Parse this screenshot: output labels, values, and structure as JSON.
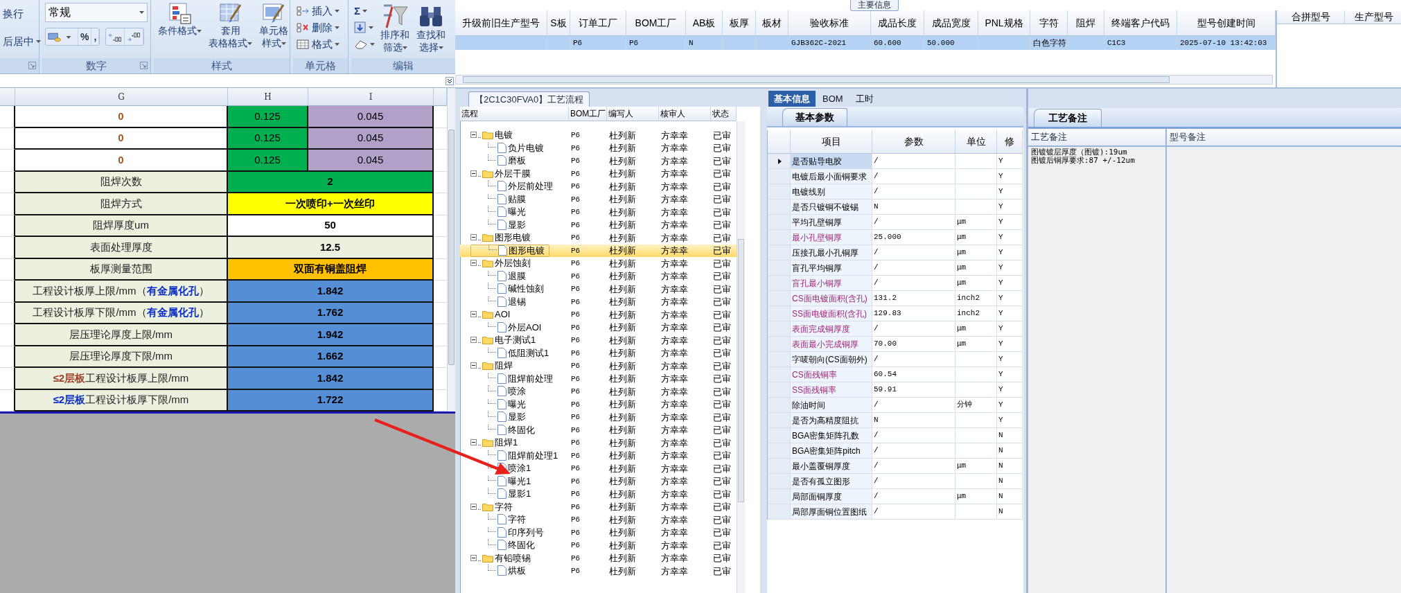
{
  "ribbon": {
    "groups": [
      {
        "kind": "alignment",
        "items": [
          "换行",
          "后居中"
        ]
      },
      {
        "kind": "number",
        "label": "数字",
        "format": "常规",
        "buttons": [
          "%",
          ","
        ]
      },
      {
        "kind": "styles",
        "label": "样式",
        "buttons": [
          {
            "lines": [
              "条件格式"
            ]
          },
          {
            "lines": [
              "套用",
              "表格格式"
            ]
          },
          {
            "lines": [
              "单元格",
              "样式"
            ]
          }
        ]
      },
      {
        "kind": "cells",
        "label": "单元格",
        "buttons": [
          "插入",
          "删除",
          "格式"
        ]
      },
      {
        "kind": "editing",
        "label": "编辑",
        "small": [
          "Σ"
        ],
        "buttons": [
          {
            "lines": [
              "排序和",
              "筛选"
            ]
          },
          {
            "lines": [
              "查找和",
              "选择"
            ]
          }
        ]
      }
    ]
  },
  "sheet": {
    "columns": [
      "G",
      "H",
      "I"
    ],
    "rows": [
      {
        "kind": "values",
        "cells": [
          {
            "text": "0",
            "color": "#ffffff"
          },
          {
            "text": "0.125",
            "color": "#00b050"
          },
          {
            "text": "0.045",
            "color": "#b1a0c7"
          }
        ]
      },
      {
        "kind": "values",
        "cells": [
          {
            "text": "0",
            "color": "#ffffff"
          },
          {
            "text": "0.125",
            "color": "#00b050"
          },
          {
            "text": "0.045",
            "color": "#b1a0c7"
          }
        ]
      },
      {
        "kind": "values",
        "cells": [
          {
            "text": "0",
            "color": "#ffffff"
          },
          {
            "text": "0.125",
            "color": "#00b050"
          },
          {
            "text": "0.045",
            "color": "#b1a0c7"
          }
        ]
      },
      {
        "kind": "merged",
        "label": "阻焊次数",
        "value": "2",
        "color": "#00b050"
      },
      {
        "kind": "merged",
        "label": "阻焊方式",
        "value": "一次喷印+一次丝印",
        "color": "#ffff00"
      },
      {
        "kind": "merged",
        "label": "阻焊厚度um",
        "value": "50",
        "color": "#ffffff"
      },
      {
        "kind": "merged",
        "label": "表面处理厚度",
        "value": "12.5",
        "color": "#ebf1de"
      },
      {
        "kind": "merged",
        "label": "板厚测量范围",
        "value": "双面有铜盖阻焊",
        "color": "#ffc000"
      },
      {
        "kind": "merged",
        "label": "工程设计板厚上限/mm（**有金属化孔**）",
        "accent": {
          "color": "#0b2fc8"
        },
        "value": "1.842",
        "color": "#558ed5"
      },
      {
        "kind": "merged",
        "label": "工程设计板厚下限/mm（**有金属化孔**）",
        "accent": {
          "color": "#0b2fc8"
        },
        "value": "1.762",
        "color": "#558ed5"
      },
      {
        "kind": "merged",
        "label": "层压理论厚度上限/mm",
        "value": "1.942",
        "color": "#558ed5"
      },
      {
        "kind": "merged",
        "label": "层压理论厚度下限/mm",
        "value": "1.662",
        "color": "#558ed5"
      },
      {
        "kind": "merged",
        "label": "**≤2层板**工程设计板厚上限/mm",
        "accent": {
          "color": "#a0402a"
        },
        "value": "1.842",
        "color": "#558ed5"
      },
      {
        "kind": "merged",
        "label": "**≤2层板**工程设计板厚下限/mm",
        "accent": {
          "color": "#0b2fc8"
        },
        "value": "1.722",
        "color": "#558ed5"
      }
    ]
  },
  "main_info": {
    "title": "主要信息",
    "columns": [
      {
        "label": "升级前旧生产型号"
      },
      {
        "label": "S板"
      },
      {
        "label": "订单工厂",
        "value": "P6"
      },
      {
        "label": "BOM工厂",
        "value": "P6"
      },
      {
        "label": "AB板",
        "value": "N"
      },
      {
        "label": "板厚"
      },
      {
        "label": "板材"
      },
      {
        "label": "验收标准",
        "value": "GJB362C-2021"
      },
      {
        "label": "成品长度",
        "value": "60.600"
      },
      {
        "label": "成品宽度",
        "value": "50.000"
      },
      {
        "label": "PNL规格"
      },
      {
        "label": "字符",
        "value": "白色字符"
      },
      {
        "label": "阻焊"
      },
      {
        "label": "终端客户代码",
        "value": "C1C3"
      },
      {
        "label": "型号创建时间",
        "value": "2025-07-10 13:42:03"
      }
    ],
    "row_selected": true,
    "side_columns": [
      "合拼型号",
      "生产型号"
    ]
  },
  "process": {
    "title": "【2C1C30FVA0】工艺流程",
    "columns": [
      "流程",
      "BOM工厂",
      "编写人",
      "核审人",
      "状态"
    ],
    "nodes": [
      {
        "name": "电镀",
        "factory": "P6",
        "writer": "杜列新",
        "reviewer": "方幸幸",
        "status": "已审",
        "expanded": true,
        "selected": false,
        "children": [
          {
            "name": "负片电镀",
            "factory": "P6",
            "writer": "杜列新",
            "reviewer": "方幸幸",
            "status": "已审",
            "selected": false
          },
          {
            "name": "磨板",
            "factory": "P6",
            "writer": "杜列新",
            "reviewer": "方幸幸",
            "status": "已审",
            "selected": false
          }
        ]
      },
      {
        "name": "外层干膜",
        "factory": "P6",
        "writer": "杜列新",
        "reviewer": "方幸幸",
        "status": "已审",
        "expanded": true,
        "selected": false,
        "children": [
          {
            "name": "外层前处理",
            "factory": "P6",
            "writer": "杜列新",
            "reviewer": "方幸幸",
            "status": "已审",
            "selected": false
          },
          {
            "name": "贴膜",
            "factory": "P6",
            "writer": "杜列新",
            "reviewer": "方幸幸",
            "status": "已审",
            "selected": false
          },
          {
            "name": "曝光",
            "factory": "P6",
            "writer": "杜列新",
            "reviewer": "方幸幸",
            "status": "已审",
            "selected": false
          },
          {
            "name": "显影",
            "factory": "P6",
            "writer": "杜列新",
            "reviewer": "方幸幸",
            "status": "已审",
            "selected": false
          }
        ]
      },
      {
        "name": "图形电镀",
        "factory": "P6",
        "writer": "杜列新",
        "reviewer": "方幸幸",
        "status": "已审",
        "expanded": true,
        "selected": false,
        "children": [
          {
            "name": "图形电镀",
            "factory": "P6",
            "writer": "杜列新",
            "reviewer": "方幸幸",
            "status": "已审",
            "selected": true
          }
        ]
      },
      {
        "name": "外层蚀刻",
        "factory": "P6",
        "writer": "杜列新",
        "reviewer": "方幸幸",
        "status": "已审",
        "expanded": true,
        "selected": false,
        "children": [
          {
            "name": "退膜",
            "factory": "P6",
            "writer": "杜列新",
            "reviewer": "方幸幸",
            "status": "已审",
            "selected": false
          },
          {
            "name": "碱性蚀刻",
            "factory": "P6",
            "writer": "杜列新",
            "reviewer": "方幸幸",
            "status": "已审",
            "selected": false
          },
          {
            "name": "退锡",
            "factory": "P6",
            "writer": "杜列新",
            "reviewer": "方幸幸",
            "status": "已审",
            "selected": false
          }
        ]
      },
      {
        "name": "AOI",
        "factory": "P6",
        "writer": "杜列新",
        "reviewer": "方幸幸",
        "status": "已审",
        "expanded": true,
        "selected": false,
        "children": [
          {
            "name": "外层AOI",
            "factory": "P6",
            "writer": "杜列新",
            "reviewer": "方幸幸",
            "status": "已审",
            "selected": false
          }
        ]
      },
      {
        "name": "电子测试1",
        "factory": "P6",
        "writer": "杜列新",
        "reviewer": "方幸幸",
        "status": "已审",
        "expanded": true,
        "selected": false,
        "children": [
          {
            "name": "低阻测试1",
            "factory": "P6",
            "writer": "杜列新",
            "reviewer": "方幸幸",
            "status": "已审",
            "selected": false
          }
        ]
      },
      {
        "name": "阻焊",
        "factory": "P6",
        "writer": "杜列新",
        "reviewer": "方幸幸",
        "status": "已审",
        "expanded": true,
        "selected": false,
        "children": [
          {
            "name": "阻焊前处理",
            "factory": "P6",
            "writer": "杜列新",
            "reviewer": "方幸幸",
            "status": "已审",
            "selected": false
          },
          {
            "name": "喷涂",
            "factory": "P6",
            "writer": "杜列新",
            "reviewer": "方幸幸",
            "status": "已审",
            "selected": false
          },
          {
            "name": "曝光",
            "factory": "P6",
            "writer": "杜列新",
            "reviewer": "方幸幸",
            "status": "已审",
            "selected": false
          },
          {
            "name": "显影",
            "factory": "P6",
            "writer": "杜列新",
            "reviewer": "方幸幸",
            "status": "已审",
            "selected": false
          },
          {
            "name": "终固化",
            "factory": "P6",
            "writer": "杜列新",
            "reviewer": "方幸幸",
            "status": "已审",
            "selected": false
          }
        ]
      },
      {
        "name": "阻焊1",
        "factory": "P6",
        "writer": "杜列新",
        "reviewer": "方幸幸",
        "status": "已审",
        "expanded": true,
        "selected": false,
        "children": [
          {
            "name": "阻焊前处理1",
            "factory": "P6",
            "writer": "杜列新",
            "reviewer": "方幸幸",
            "status": "已审",
            "selected": false
          },
          {
            "name": "喷涂1",
            "factory": "P6",
            "writer": "杜列新",
            "reviewer": "方幸幸",
            "status": "已审",
            "selected": false
          },
          {
            "name": "曝光1",
            "factory": "P6",
            "writer": "杜列新",
            "reviewer": "方幸幸",
            "status": "已审",
            "selected": false
          },
          {
            "name": "显影1",
            "factory": "P6",
            "writer": "杜列新",
            "reviewer": "方幸幸",
            "status": "已审",
            "selected": false
          }
        ]
      },
      {
        "name": "字符",
        "factory": "P6",
        "writer": "杜列新",
        "reviewer": "方幸幸",
        "status": "已审",
        "expanded": true,
        "selected": false,
        "children": [
          {
            "name": "字符",
            "factory": "P6",
            "writer": "杜列新",
            "reviewer": "方幸幸",
            "status": "已审",
            "selected": false
          },
          {
            "name": "印序列号",
            "factory": "P6",
            "writer": "杜列新",
            "reviewer": "方幸幸",
            "status": "已审",
            "selected": false
          },
          {
            "name": "终固化",
            "factory": "P6",
            "writer": "杜列新",
            "reviewer": "方幸幸",
            "status": "已审",
            "selected": false
          }
        ]
      },
      {
        "name": "有铅喷锡",
        "factory": "P6",
        "writer": "杜列新",
        "reviewer": "方幸幸",
        "status": "已审",
        "expanded": true,
        "selected": false,
        "children": [
          {
            "name": "烘板",
            "factory": "P6",
            "writer": "杜列新",
            "reviewer": "方幸幸",
            "status": "已审",
            "selected": false
          }
        ]
      }
    ]
  },
  "basic_info": {
    "tabs": [
      {
        "label": "基本信息",
        "selected": true
      },
      {
        "label": "BOM",
        "selected": false
      },
      {
        "label": "工时",
        "selected": false
      }
    ],
    "subtab": "基本参数",
    "columns": [
      "项目",
      "参数",
      "单位",
      "修"
    ],
    "rows": [
      {
        "item": "是否贴导电胶",
        "value": "/",
        "modified": "Y",
        "highlighted": false,
        "current": true
      },
      {
        "item": "电镀后最小面铜要求",
        "value": "/",
        "modified": "Y",
        "highlighted": false,
        "current": false
      },
      {
        "item": "电镀线别",
        "value": "/",
        "modified": "Y",
        "highlighted": false,
        "current": false
      },
      {
        "item": "是否只镀铜不镀锡",
        "value": "N",
        "modified": "Y",
        "highlighted": false,
        "current": false
      },
      {
        "item": "平均孔壁铜厚",
        "value": "/",
        "unit": "μm",
        "modified": "Y",
        "highlighted": false,
        "current": false
      },
      {
        "item": "最小孔壁铜厚",
        "value": "25.000",
        "unit": "μm",
        "modified": "Y",
        "highlighted": true,
        "current": false
      },
      {
        "item": "压接孔最小孔铜厚",
        "value": "/",
        "unit": "μm",
        "modified": "Y",
        "highlighted": false,
        "current": false
      },
      {
        "item": "盲孔平均铜厚",
        "value": "/",
        "unit": "μm",
        "modified": "Y",
        "highlighted": false,
        "current": false
      },
      {
        "item": "盲孔最小铜厚",
        "value": "/",
        "unit": "μm",
        "modified": "Y",
        "highlighted": true,
        "current": false
      },
      {
        "item": "CS面电镀面积(含孔)",
        "value": "131.2",
        "unit": "inch2",
        "modified": "Y",
        "highlighted": true,
        "current": false
      },
      {
        "item": "SS面电镀面积(含孔)",
        "value": "129.83",
        "unit": "inch2",
        "modified": "Y",
        "highlighted": true,
        "current": false
      },
      {
        "item": "表面完成铜厚度",
        "value": "/",
        "unit": "μm",
        "modified": "Y",
        "highlighted": true,
        "current": false
      },
      {
        "item": "表面最小完成铜厚",
        "value": "70.00",
        "unit": "μm",
        "modified": "Y",
        "highlighted": true,
        "current": false
      },
      {
        "item": "字唛朝向(CS面朝外)",
        "value": "/",
        "modified": "Y",
        "highlighted": false,
        "current": false
      },
      {
        "item": "CS面残铜率",
        "value": "60.54",
        "modified": "Y",
        "highlighted": true,
        "current": false
      },
      {
        "item": "SS面残铜率",
        "value": "59.91",
        "modified": "Y",
        "highlighted": true,
        "current": false
      },
      {
        "item": "除油时间",
        "value": "/",
        "unit": "分钟",
        "modified": "Y",
        "highlighted": false,
        "current": false
      },
      {
        "item": "是否为高精度阻抗",
        "value": "N",
        "modified": "Y",
        "highlighted": false,
        "current": false
      },
      {
        "item": "BGA密集矩阵孔数",
        "value": "/",
        "modified": "N",
        "highlighted": false,
        "current": false
      },
      {
        "item": "BGA密集矩阵pitch",
        "value": "/",
        "modified": "N",
        "highlighted": false,
        "current": false
      },
      {
        "item": "最小盖覆铜厚度",
        "value": "/",
        "unit": "μm",
        "modified": "N",
        "highlighted": false,
        "current": false
      },
      {
        "item": "是否有孤立图形",
        "value": "/",
        "modified": "N",
        "highlighted": false,
        "current": false
      },
      {
        "item": "局部面铜厚度",
        "value": "/",
        "unit": "μm",
        "modified": "N",
        "highlighted": false,
        "current": false
      },
      {
        "item": "局部厚面铜位置图纸",
        "value": "/",
        "modified": "N",
        "highlighted": false,
        "current": false
      }
    ]
  },
  "notes": {
    "tab": "工艺备注",
    "columns": [
      "工艺备注",
      "型号备注"
    ],
    "lines": [
      "图镀镀层厚度（图镀):19um",
      "图镀后铜厚要求:87 +/-12um"
    ]
  }
}
